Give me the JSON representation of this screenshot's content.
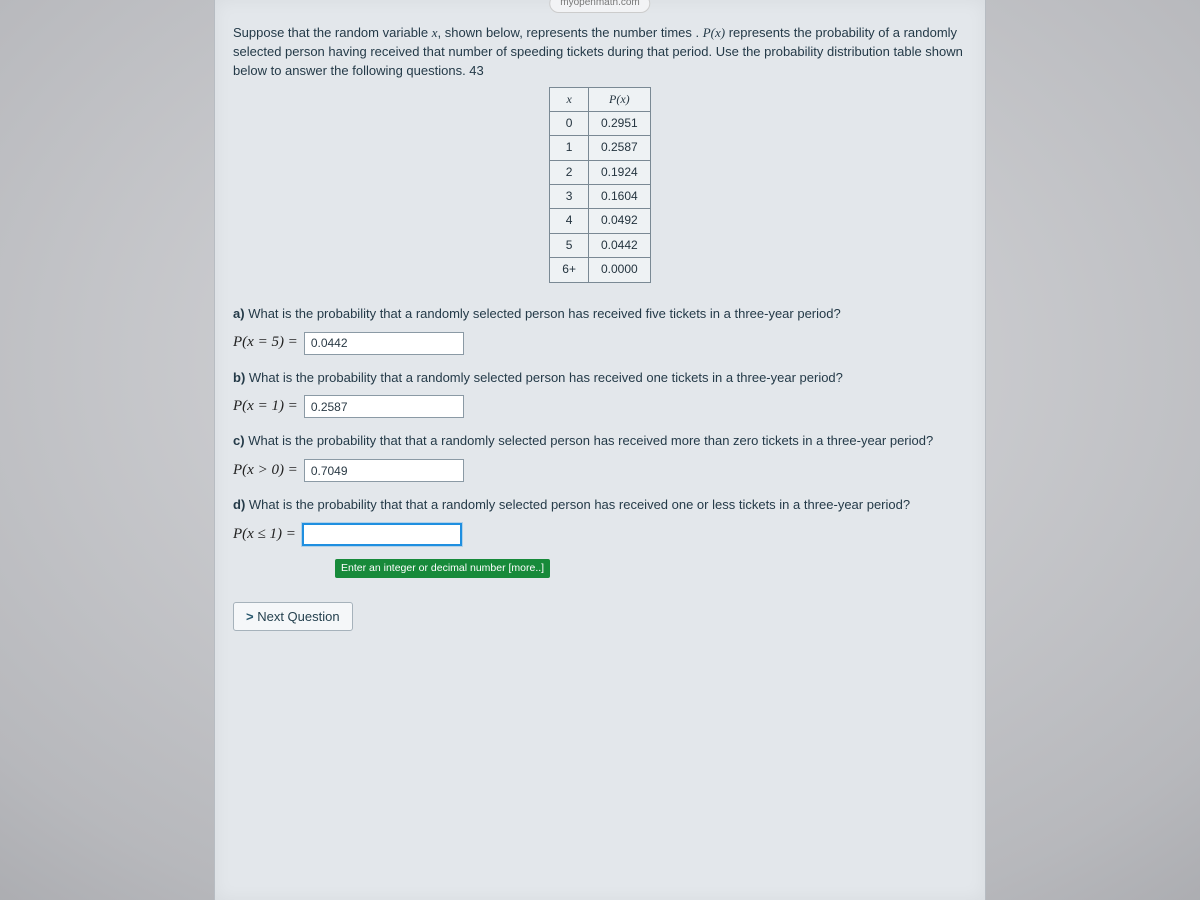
{
  "address_bar": "myopenmath.com",
  "intro_part1": "Suppose that the random variable ",
  "intro_var": "x",
  "intro_part2": ", shown below, represents the number times . ",
  "intro_px": "P(x)",
  "intro_part3": " represents the probability of a randomly selected person having received that number of speeding tickets during that period. Use the probability distribution table shown below to answer the following questions. 43",
  "table": {
    "head_x": "x",
    "head_px": "P(x)",
    "rows": [
      {
        "x": "0",
        "p": "0.2951"
      },
      {
        "x": "1",
        "p": "0.2587"
      },
      {
        "x": "2",
        "p": "0.1924"
      },
      {
        "x": "3",
        "p": "0.1604"
      },
      {
        "x": "4",
        "p": "0.0492"
      },
      {
        "x": "5",
        "p": "0.0442"
      },
      {
        "x": "6+",
        "p": "0.0000"
      }
    ]
  },
  "qa": {
    "label": "a)",
    "text": "What is the probability that a randomly selected person has received five tickets in a three-year period?",
    "expr": "P(x = 5) =",
    "value": "0.0442"
  },
  "qb": {
    "label": "b)",
    "text": "What is the probability that a randomly selected person has received one tickets in a three-year period?",
    "expr": "P(x = 1) =",
    "value": "0.2587"
  },
  "qc": {
    "label": "c)",
    "text": "What is the probability that that a randomly selected person has received more than zero tickets in a three-year period?",
    "expr": "P(x > 0) =",
    "value": "0.7049"
  },
  "qd": {
    "label": "d)",
    "text": "What is the probability that that a randomly selected person has received one or less tickets in a three-year period?",
    "expr": "P(x ≤ 1) =",
    "value": "",
    "hint": "Enter an integer or decimal number [more..]"
  },
  "next_button": "Next Question"
}
